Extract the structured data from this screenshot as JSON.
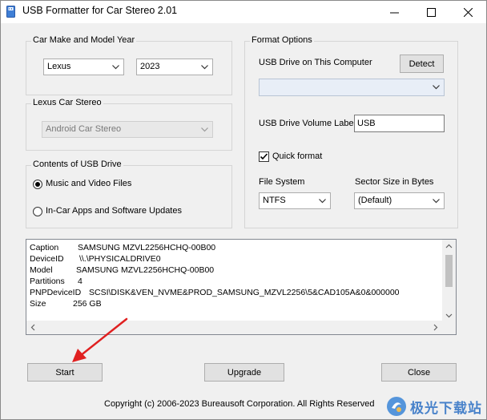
{
  "window": {
    "title": "USB Formatter for Car Stereo 2.01",
    "controls": [
      "minimize",
      "maximize",
      "close"
    ]
  },
  "car_make_group": {
    "label": "Car Make and Model Year",
    "make_value": "Lexus",
    "year_value": "2023"
  },
  "car_stereo_group": {
    "label": "Lexus Car Stereo",
    "stereo_value": "Android Car Stereo"
  },
  "contents_group": {
    "label": "Contents of USB Drive",
    "options": [
      {
        "label": "Music and Video Files",
        "selected": true
      },
      {
        "label": "In-Car Apps and Software Updates",
        "selected": false
      }
    ]
  },
  "format_group": {
    "label": "Format Options",
    "usb_drive_label": "USB Drive on This Computer",
    "detect_button": "Detect",
    "usb_drive_value": "",
    "volume_label_caption": "USB Drive Volume Label",
    "volume_label_value": "USB",
    "quick_format_label": "Quick format",
    "quick_format_checked": true,
    "file_system_label": "File System",
    "file_system_value": "NTFS",
    "sector_size_label": "Sector Size in Bytes",
    "sector_size_value": "(Default)"
  },
  "device_info": [
    {
      "key": "Caption",
      "value": "SAMSUNG MZVL2256HCHQ-00B00"
    },
    {
      "key": "DeviceID",
      "value": "\\\\.\\PHYSICALDRIVE0"
    },
    {
      "key": "Model",
      "value": "SAMSUNG MZVL2256HCHQ-00B00"
    },
    {
      "key": "Partitions",
      "value": "4"
    },
    {
      "key": "PNPDeviceID",
      "value": "SCSI\\DISK&VEN_NVME&PROD_SAMSUNG_MZVL2256\\5&CAD105A&0&000000"
    },
    {
      "key": "Size",
      "value": "256 GB"
    }
  ],
  "buttons": {
    "start": "Start",
    "upgrade": "Upgrade",
    "close": "Close"
  },
  "copyright": "Copyright (c) 2006-2023 Bureausoft Corporation. All Rights Reserved",
  "watermark": {
    "text": "极光下载站"
  },
  "colors": {
    "window_bg": "#f0f0f0",
    "button_bg": "#e1e1e1",
    "annotation_arrow": "#e02020"
  }
}
